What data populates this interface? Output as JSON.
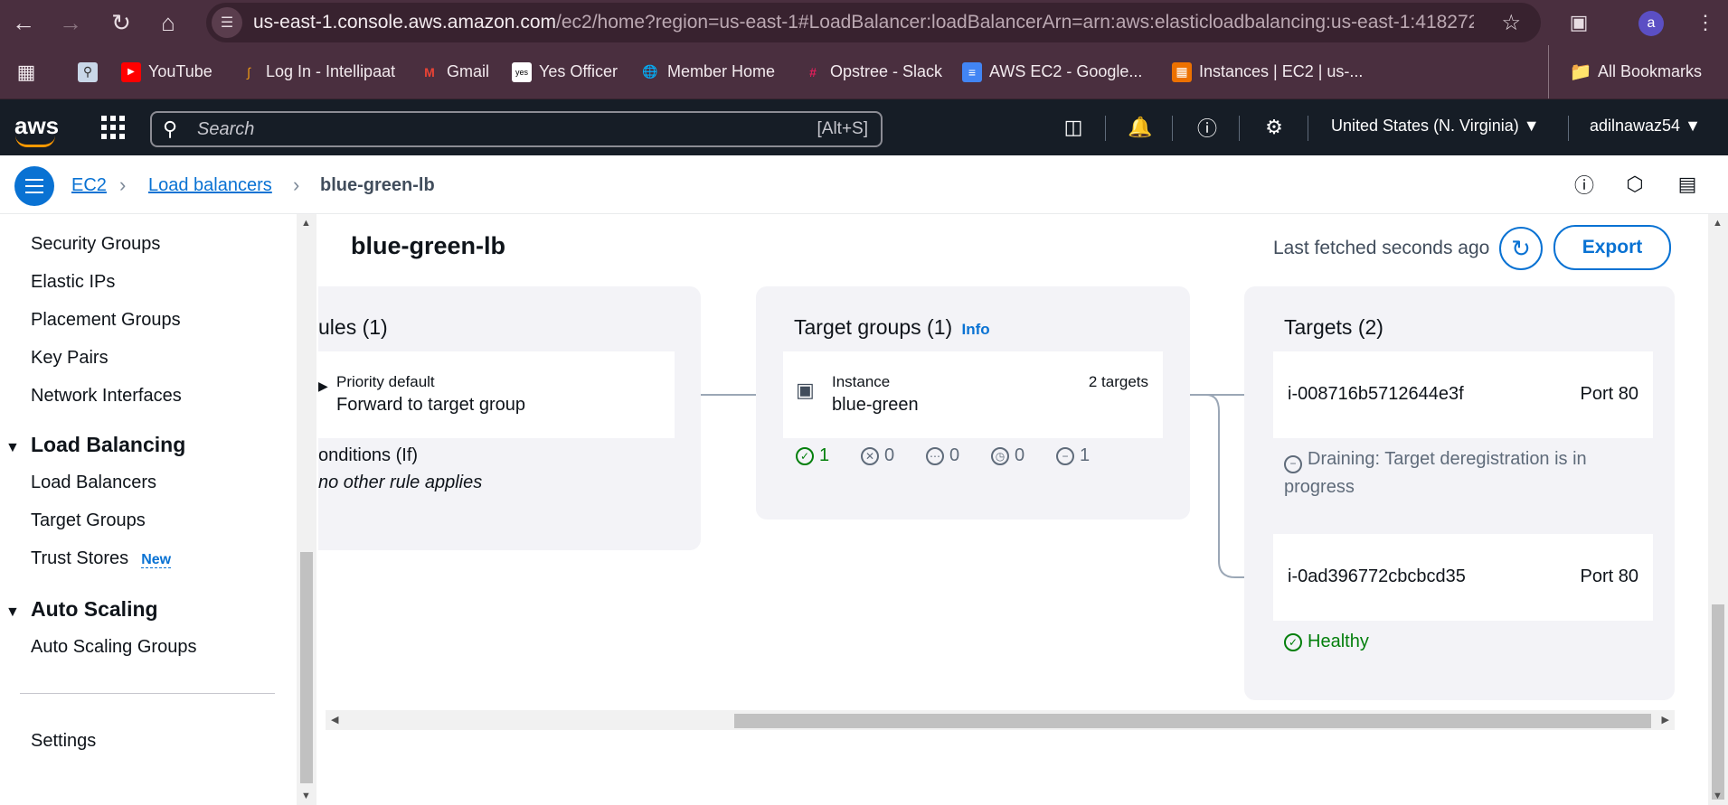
{
  "browser": {
    "url": "us-east-1.console.aws.amazon.com",
    "url_path": "/ec2/home?region=us-east-1#LoadBalancer:loadBalancerArn=arn:aws:elasticloadbalancing:us-east-1:4182727...",
    "profile_initial": "a",
    "bookmarks": [
      "YouTube",
      "Log In - Intellipaat",
      "Gmail",
      "Yes Officer",
      "Member Home",
      "Opstree - Slack",
      "AWS EC2 - Google...",
      "Instances | EC2 | us-..."
    ],
    "all_bookmarks": "All Bookmarks"
  },
  "aws_header": {
    "logo": "aws",
    "search_placeholder": "Search",
    "search_shortcut": "[Alt+S]",
    "region": "United States (N. Virginia) ▼",
    "account": "adilnawaz54 ▼"
  },
  "breadcrumb": {
    "items": [
      "EC2",
      "Load balancers"
    ],
    "current": "blue-green-lb"
  },
  "sidebar": {
    "items_top": [
      "Security Groups",
      "Elastic IPs",
      "Placement Groups",
      "Key Pairs",
      "Network Interfaces"
    ],
    "section_lb": "Load Balancing",
    "lb_items": [
      "Load Balancers",
      "Target Groups",
      "Trust Stores"
    ],
    "new_badge": "New",
    "section_as": "Auto Scaling",
    "as_items": [
      "Auto Scaling Groups"
    ],
    "settings": "Settings"
  },
  "main": {
    "title": "blue-green-lb",
    "last_fetched": "Last fetched seconds ago",
    "export_label": "Export",
    "rules_panel": {
      "title": "ules (1)",
      "priority": "Priority default",
      "action": "Forward to target group",
      "conditions": "onditions (If)",
      "condition_text": "no other rule applies"
    },
    "tg_panel": {
      "title": "Target groups (1)",
      "info": "Info",
      "type": "Instance",
      "name": "blue-green",
      "count": "2 targets",
      "stats": [
        "1",
        "0",
        "0",
        "0",
        "1"
      ]
    },
    "targets_panel": {
      "title": "Targets (2)",
      "targets": [
        {
          "id": "i-008716b5712644e3f",
          "port": "Port 80",
          "status": "Draining: Target deregistration is in progress"
        },
        {
          "id": "i-0ad396772cbcbcd35",
          "port": "Port 80",
          "status": "Healthy"
        }
      ]
    }
  },
  "colors": {
    "aws_header": "#161d26",
    "link_blue": "#0972d3",
    "healthy_green": "#037f0c",
    "browser_chrome": "#4a2f3f"
  }
}
